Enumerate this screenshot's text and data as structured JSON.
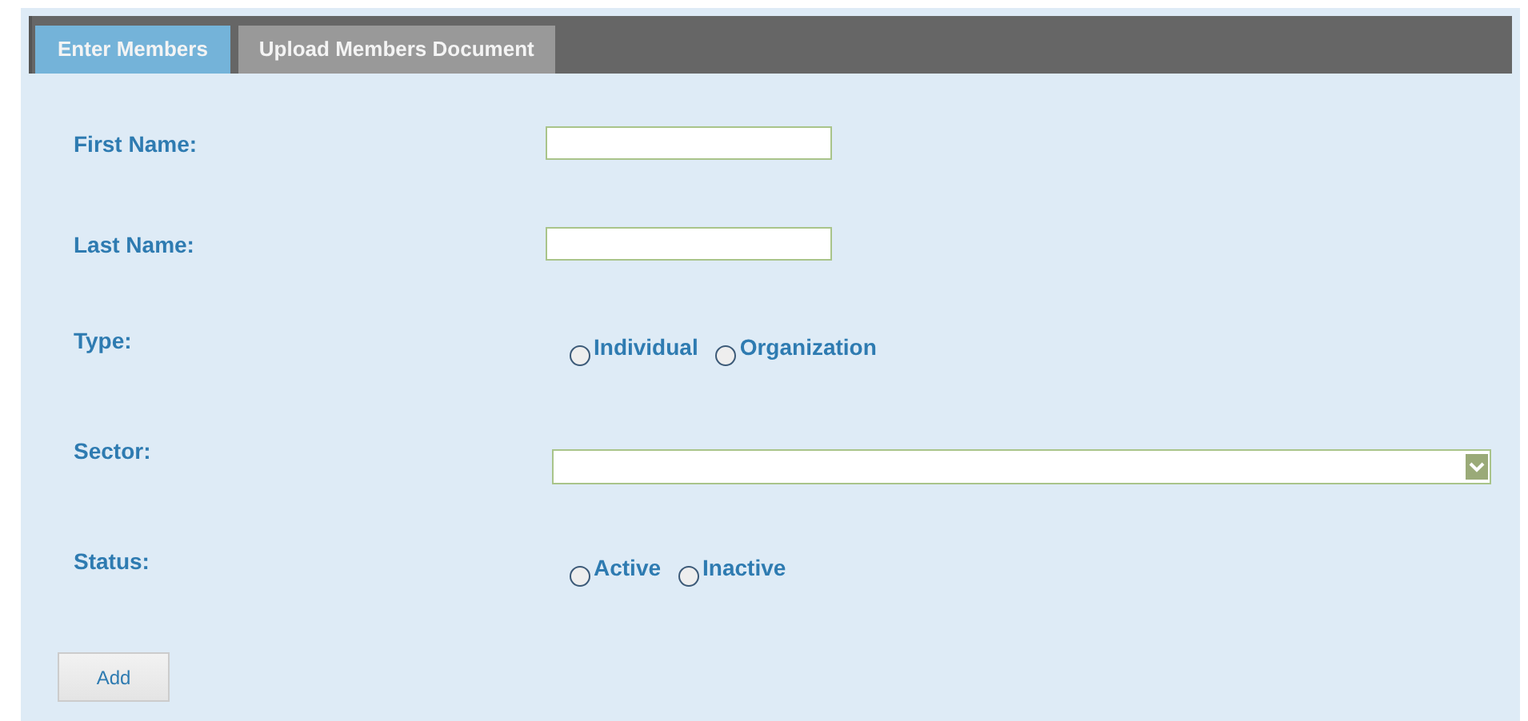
{
  "tabs": [
    {
      "label": "Enter Members",
      "selected": true
    },
    {
      "label": "Upload Members Document",
      "selected": false
    }
  ],
  "fields": [
    {
      "kind": "text",
      "label": "First Name:"
    },
    {
      "kind": "text",
      "label": "Last Name:"
    },
    {
      "kind": "radio",
      "label": "Type:",
      "options": [
        {
          "label": "Individual",
          "selected": false
        },
        {
          "label": "Organization",
          "selected": false
        }
      ]
    },
    {
      "kind": "select",
      "label": "Sector:"
    },
    {
      "kind": "radio",
      "label": "Status:",
      "options": [
        {
          "label": "Active",
          "selected": false
        },
        {
          "label": "Inactive",
          "selected": false
        }
      ]
    }
  ],
  "button": "Add"
}
